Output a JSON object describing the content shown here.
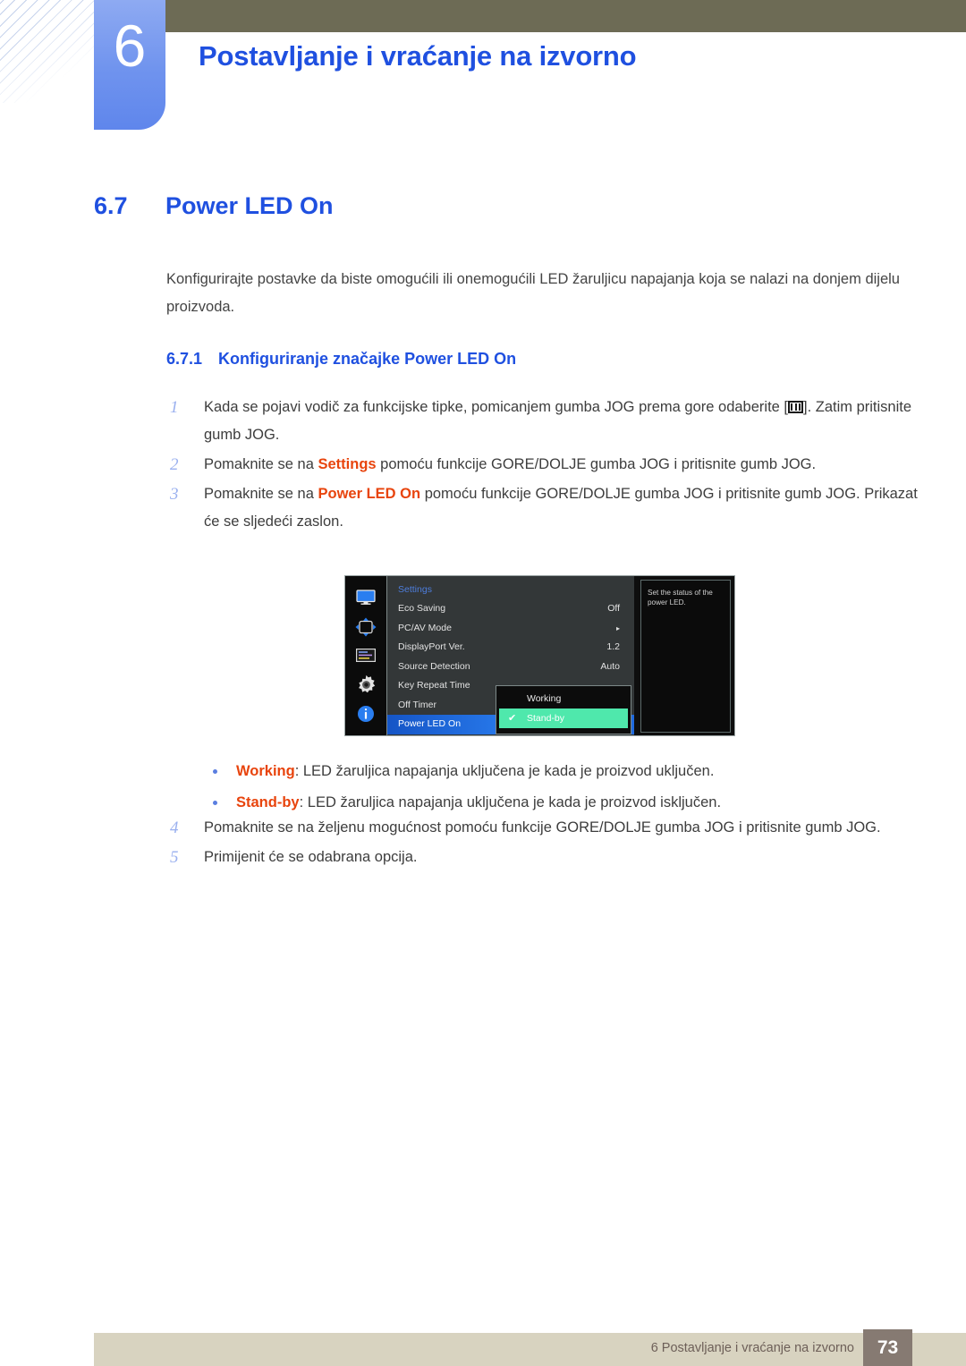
{
  "header": {
    "chapter_number": "6",
    "chapter_title": "Postavljanje i vraćanje na izvorno"
  },
  "section": {
    "number": "6.7",
    "title": "Power LED On",
    "intro": "Konfigurirajte postavke da biste omogućili ili onemogućili LED žaruljicu napajanja koja se nalazi na donjem dijelu proizvoda.",
    "subsection_number": "6.7.1",
    "subsection_title": "Konfiguriranje značajke Power LED On"
  },
  "steps": {
    "s1_num": "1",
    "s1_a": "Kada se pojavi vodič za funkcijske tipke, pomicanjem gumba JOG prema gore odaberite [",
    "s1_b": "]. Zatim pritisnite gumb JOG.",
    "s2_num": "2",
    "s2_a": "Pomaknite se na ",
    "s2_bold": "Settings",
    "s2_b": " pomoću funkcije GORE/DOLJE gumba JOG i pritisnite gumb JOG.",
    "s3_num": "3",
    "s3_a": "Pomaknite se na ",
    "s3_bold": "Power LED On",
    "s3_b": " pomoću funkcije GORE/DOLJE gumba JOG i pritisnite gumb JOG. Prikazat će se sljedeći zaslon.",
    "s4_num": "4",
    "s4_text": "Pomaknite se na željenu mogućnost pomoću funkcije GORE/DOLJE gumba JOG i pritisnite gumb JOG.",
    "s5_num": "5",
    "s5_text": "Primijenit će se odabrana opcija."
  },
  "osd": {
    "title": "Settings",
    "rows": [
      {
        "label": "Eco Saving",
        "value": "Off"
      },
      {
        "label": "PC/AV Mode",
        "value": "▸"
      },
      {
        "label": "DisplayPort Ver.",
        "value": "1.2"
      },
      {
        "label": "Source Detection",
        "value": "Auto"
      },
      {
        "label": "Key Repeat Time",
        "value": ""
      },
      {
        "label": "Off Timer",
        "value": ""
      },
      {
        "label": "Power LED On",
        "value": ""
      }
    ],
    "help_text": "Set the status of the power LED.",
    "popup": {
      "option_working": "Working",
      "option_standby": "Stand-by",
      "check_glyph": "✔"
    },
    "icons": [
      "monitor-icon",
      "resize-arrows-icon",
      "osd-sliders-icon",
      "gear-icon",
      "info-icon"
    ]
  },
  "bullets": [
    {
      "term": "Working",
      "text": ": LED žaruljica napajanja uključena je kada je proizvod uključen."
    },
    {
      "term": "Stand-by",
      "text": ": LED žaruljica napajanja uključena je kada je proizvod isključen."
    }
  ],
  "footer": {
    "text": "6 Postavljanje i vraćanje na izvorno",
    "page": "73"
  },
  "colors": {
    "accent_blue": "#1f50e0",
    "highlight_orange": "#e8440d",
    "header_olive": "#6d6b55",
    "footer_beige": "#d8d3c0",
    "osd_green": "#4fe8ac"
  }
}
